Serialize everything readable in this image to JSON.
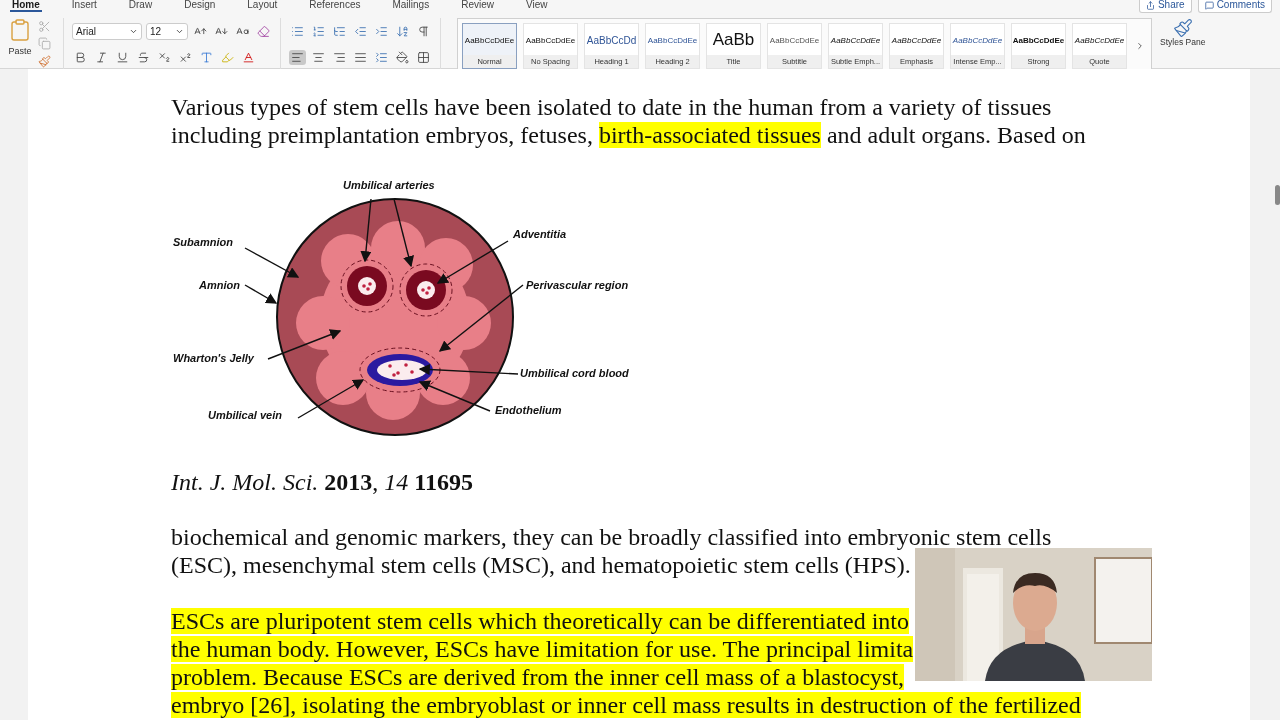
{
  "ribbon": {
    "tabs": [
      {
        "label": "Home",
        "selected": true
      },
      {
        "label": "Insert",
        "selected": false
      },
      {
        "label": "Draw",
        "selected": false
      },
      {
        "label": "Design",
        "selected": false
      },
      {
        "label": "Layout",
        "selected": false
      },
      {
        "label": "References",
        "selected": false
      },
      {
        "label": "Mailings",
        "selected": false
      },
      {
        "label": "Review",
        "selected": false
      },
      {
        "label": "View",
        "selected": false
      }
    ],
    "share": "Share",
    "comments": "Comments",
    "paste_label": "Paste",
    "font": {
      "value": "Arial"
    },
    "size": {
      "value": "12"
    },
    "align": [
      {
        "kind": "left",
        "selected": true
      },
      {
        "kind": "center",
        "selected": false
      },
      {
        "kind": "right",
        "selected": false
      },
      {
        "kind": "justify",
        "selected": false
      }
    ],
    "styles": [
      {
        "preview": "AaBbCcDdEe",
        "label": "Normal",
        "kind": "plain",
        "selected": true
      },
      {
        "preview": "AaBbCcDdEe",
        "label": "No Spacing",
        "kind": "plain",
        "selected": false
      },
      {
        "preview": "AaBbCcDd",
        "label": "Heading 1",
        "kind": "heading1",
        "selected": false
      },
      {
        "preview": "AaBbCcDdEe",
        "label": "Heading 2",
        "kind": "heading2",
        "selected": false
      },
      {
        "preview": "AaBb",
        "label": "Title",
        "kind": "title",
        "selected": false
      },
      {
        "preview": "AaBbCcDdEe",
        "label": "Subtitle",
        "kind": "subtitle",
        "selected": false
      },
      {
        "preview": "AaBbCcDdEe",
        "label": "Subtle Emph...",
        "kind": "italic",
        "selected": false
      },
      {
        "preview": "AaBbCcDdEe",
        "label": "Emphasis",
        "kind": "italic",
        "selected": false
      },
      {
        "preview": "AaBbCcDdEe",
        "label": "Intense Emp...",
        "kind": "intense",
        "selected": false
      },
      {
        "preview": "AaBbCcDdEe",
        "label": "Strong",
        "kind": "strong",
        "selected": false
      },
      {
        "preview": "AaBbCcDdEe",
        "label": "Quote",
        "kind": "italic",
        "selected": false
      }
    ],
    "styles_pane": "Styles Pane"
  },
  "document": {
    "blocks": [
      {
        "kind": "paragraph",
        "lines": [
          [
            {
              "text": "Various types of stem cells have been isolated to date in the human from a variety of tissues",
              "highlighted": false
            }
          ],
          [
            {
              "text": "including preimplantation embryos, fetuses, ",
              "highlighted": false
            },
            {
              "text": "birth-associated tissues",
              "highlighted": true
            },
            {
              "text": " and adult organs. Based on",
              "highlighted": false
            }
          ]
        ]
      },
      {
        "kind": "figure",
        "labels": [
          "Umbilical arteries",
          "Subamnion",
          "Adventitia",
          "Amnion",
          "Perivascular region",
          "Wharton's Jelly",
          "Umbilical cord blood",
          "Endothelium",
          "Umbilical vein"
        ]
      },
      {
        "kind": "citation",
        "text": "*Int. J. Mol. Sci.* **2013**, *14* **11695**"
      },
      {
        "kind": "paragraph",
        "lines": [
          [
            {
              "text": "biochemical and genomic markers, they can be broadly classified into embryonic stem cells",
              "highlighted": false
            }
          ],
          [
            {
              "text": "(ESC), mesenchymal stem cells (MSC), and hematopoietic stem cells (HPS).",
              "highlighted": false
            }
          ]
        ]
      },
      {
        "kind": "paragraph",
        "lines": [
          [
            {
              "text": "ESCs are pluripotent stem cells which theoretically can be differentiated into",
              "highlighted": true
            }
          ],
          [
            {
              "text": "the human body. However, ESCs have limitation for use. The principal limita",
              "highlighted": true
            }
          ],
          [
            {
              "text": "problem. Because ESCs are derived from the inner cell mass of a blastocyst,",
              "highlighted": true
            }
          ],
          [
            {
              "text": "embryo [26], isolating the embryoblast or inner cell mass results in destruction of the fertilized",
              "highlighted": true
            }
          ]
        ]
      }
    ]
  }
}
